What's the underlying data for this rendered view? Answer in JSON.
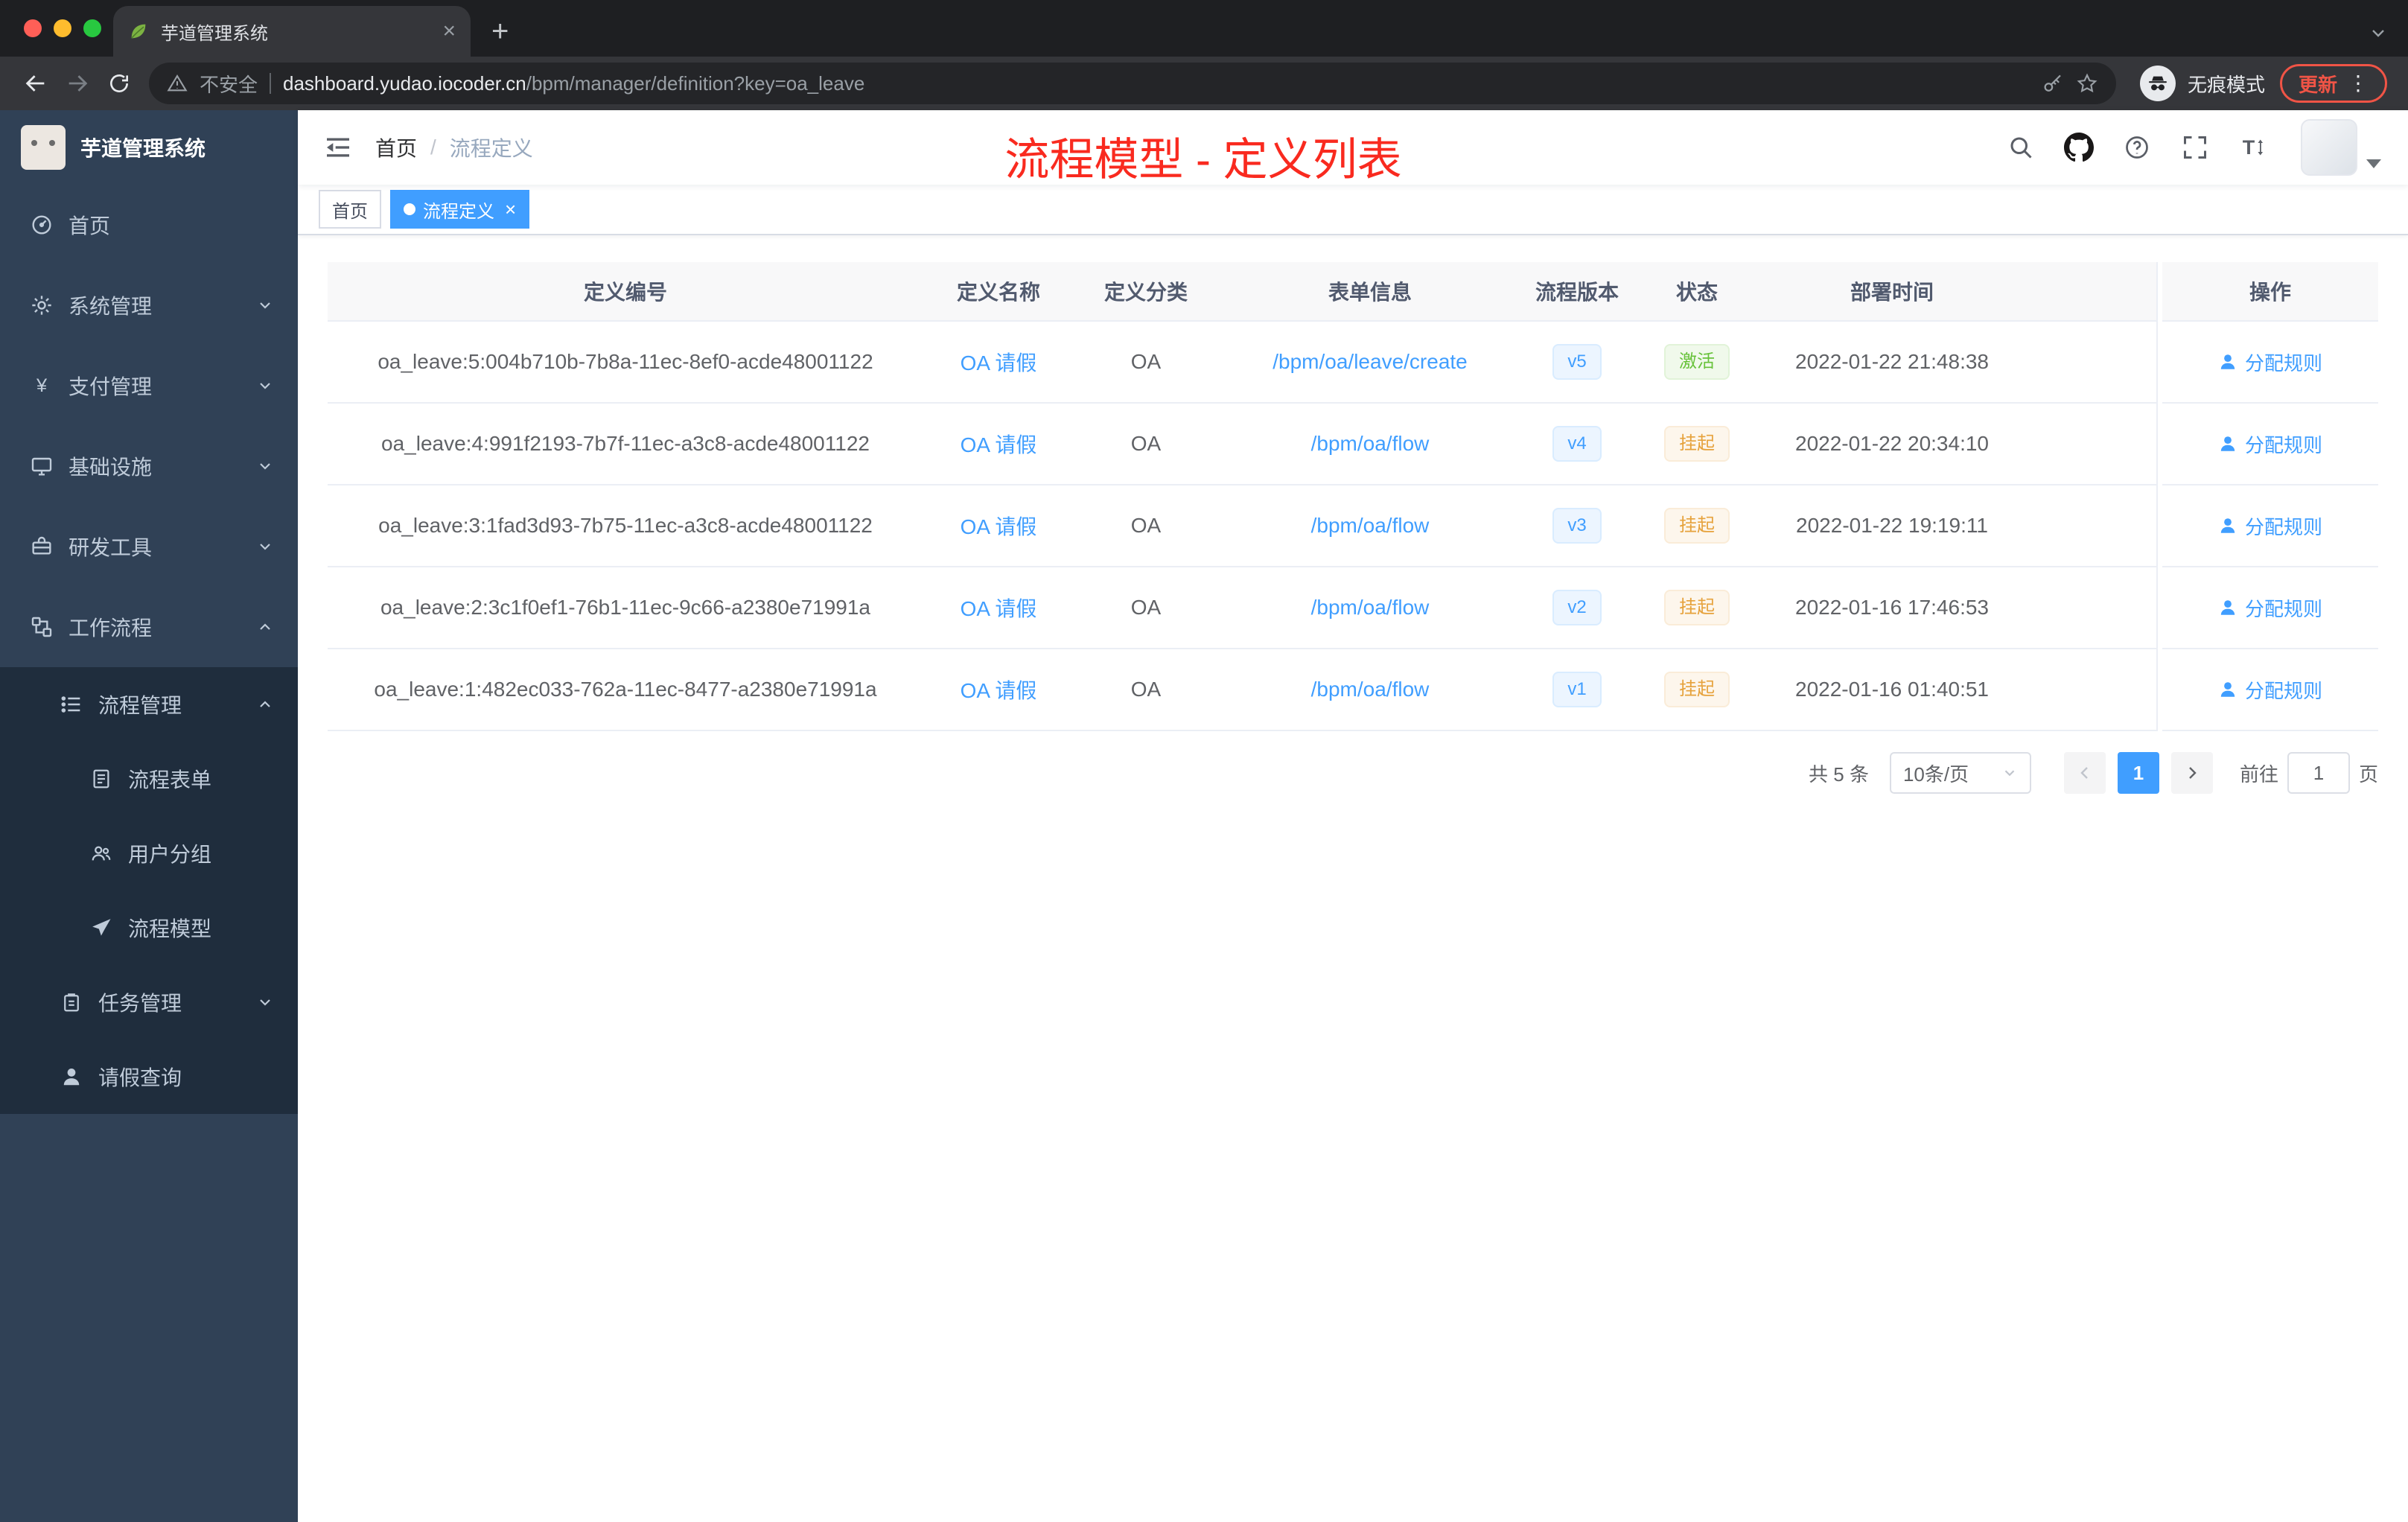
{
  "browser": {
    "tab": {
      "title": "芋道管理系统"
    },
    "security_label": "不安全",
    "url_host": "dashboard.yudao.iocoder.cn",
    "url_path": "/bpm/manager/definition?key=oa_leave",
    "incognito_label": "无痕模式",
    "update_label": "更新"
  },
  "sidebar": {
    "title": "芋道管理系统",
    "menu": [
      {
        "label": "首页"
      },
      {
        "label": "系统管理"
      },
      {
        "label": "支付管理"
      },
      {
        "label": "基础设施"
      },
      {
        "label": "研发工具"
      },
      {
        "label": "工作流程"
      },
      {
        "label": "流程管理"
      },
      {
        "label": "流程表单"
      },
      {
        "label": "用户分组"
      },
      {
        "label": "流程模型"
      },
      {
        "label": "任务管理"
      },
      {
        "label": "请假查询"
      }
    ]
  },
  "header": {
    "breadcrumb": {
      "home": "首页",
      "separator": "/",
      "current": "流程定义"
    },
    "annotation": "流程模型 - 定义列表"
  },
  "tags": {
    "home": "首页",
    "active": "流程定义"
  },
  "table": {
    "columns": [
      "定义编号",
      "定义名称",
      "定义分类",
      "表单信息",
      "流程版本",
      "状态",
      "部署时间",
      "操作"
    ],
    "rows": [
      {
        "id": "oa_leave:5:004b710b-7b8a-11ec-8ef0-acde48001122",
        "name": "OA 请假",
        "category": "OA",
        "form": "/bpm/oa/leave/create",
        "version": "v5",
        "status": "激活",
        "status_type": "success",
        "time": "2022-01-22 21:48:38",
        "action": "分配规则"
      },
      {
        "id": "oa_leave:4:991f2193-7b7f-11ec-a3c8-acde48001122",
        "name": "OA 请假",
        "category": "OA",
        "form": "/bpm/oa/flow",
        "version": "v4",
        "status": "挂起",
        "status_type": "warning",
        "time": "2022-01-22 20:34:10",
        "action": "分配规则"
      },
      {
        "id": "oa_leave:3:1fad3d93-7b75-11ec-a3c8-acde48001122",
        "name": "OA 请假",
        "category": "OA",
        "form": "/bpm/oa/flow",
        "version": "v3",
        "status": "挂起",
        "status_type": "warning",
        "time": "2022-01-22 19:19:11",
        "action": "分配规则"
      },
      {
        "id": "oa_leave:2:3c1f0ef1-76b1-11ec-9c66-a2380e71991a",
        "name": "OA 请假",
        "category": "OA",
        "form": "/bpm/oa/flow",
        "version": "v2",
        "status": "挂起",
        "status_type": "warning",
        "time": "2022-01-16 17:46:53",
        "action": "分配规则"
      },
      {
        "id": "oa_leave:1:482ec033-762a-11ec-8477-a2380e71991a",
        "name": "OA 请假",
        "category": "OA",
        "form": "/bpm/oa/flow",
        "version": "v1",
        "status": "挂起",
        "status_type": "warning",
        "time": "2022-01-16 01:40:51",
        "action": "分配规则"
      }
    ]
  },
  "pagination": {
    "total": "共 5 条",
    "page_size": "10条/页",
    "page": "1",
    "goto": "前往",
    "goto_value": "1",
    "unit": "页"
  },
  "colors": {
    "primary": "#409eff",
    "success": "#67c23a",
    "warning": "#e6a23c",
    "sidebar_bg": "#304156",
    "submenu_bg": "#1f2d3d",
    "annotation": "#f92a1f"
  }
}
